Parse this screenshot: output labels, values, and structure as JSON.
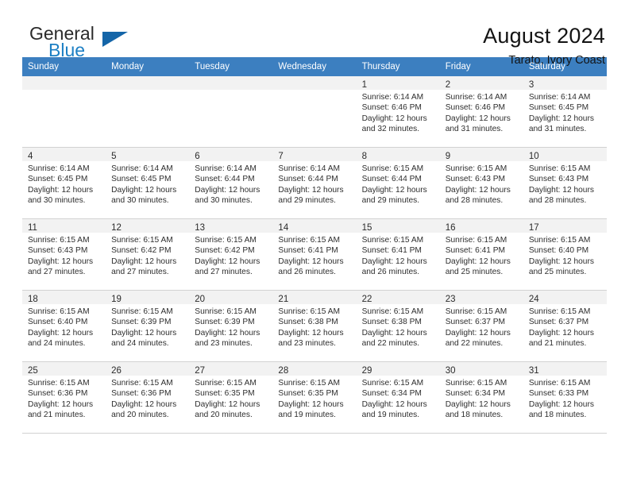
{
  "brand": {
    "name_part1": "General",
    "name_part2": "Blue",
    "flag_icon": "flag-triangle-icon"
  },
  "header": {
    "title": "August 2024",
    "subtitle": "Tarato, Ivory Coast"
  },
  "colors": {
    "header_row": "#3c7fc0",
    "brand_blue": "#1c7fc4",
    "daynum_bar": "#f2f2f2",
    "cell_border": "#d2d2d2"
  },
  "weekdays": [
    "Sunday",
    "Monday",
    "Tuesday",
    "Wednesday",
    "Thursday",
    "Friday",
    "Saturday"
  ],
  "labels": {
    "sunrise_prefix": "Sunrise:",
    "sunset_prefix": "Sunset:",
    "daylight_prefix": "Daylight:"
  },
  "weeks": [
    [
      {
        "day": "",
        "lines": []
      },
      {
        "day": "",
        "lines": []
      },
      {
        "day": "",
        "lines": []
      },
      {
        "day": "",
        "lines": []
      },
      {
        "day": "1",
        "lines": [
          "Sunrise: 6:14 AM",
          "Sunset: 6:46 PM",
          "Daylight: 12 hours",
          "and 32 minutes."
        ]
      },
      {
        "day": "2",
        "lines": [
          "Sunrise: 6:14 AM",
          "Sunset: 6:46 PM",
          "Daylight: 12 hours",
          "and 31 minutes."
        ]
      },
      {
        "day": "3",
        "lines": [
          "Sunrise: 6:14 AM",
          "Sunset: 6:45 PM",
          "Daylight: 12 hours",
          "and 31 minutes."
        ]
      }
    ],
    [
      {
        "day": "4",
        "lines": [
          "Sunrise: 6:14 AM",
          "Sunset: 6:45 PM",
          "Daylight: 12 hours",
          "and 30 minutes."
        ]
      },
      {
        "day": "5",
        "lines": [
          "Sunrise: 6:14 AM",
          "Sunset: 6:45 PM",
          "Daylight: 12 hours",
          "and 30 minutes."
        ]
      },
      {
        "day": "6",
        "lines": [
          "Sunrise: 6:14 AM",
          "Sunset: 6:44 PM",
          "Daylight: 12 hours",
          "and 30 minutes."
        ]
      },
      {
        "day": "7",
        "lines": [
          "Sunrise: 6:14 AM",
          "Sunset: 6:44 PM",
          "Daylight: 12 hours",
          "and 29 minutes."
        ]
      },
      {
        "day": "8",
        "lines": [
          "Sunrise: 6:15 AM",
          "Sunset: 6:44 PM",
          "Daylight: 12 hours",
          "and 29 minutes."
        ]
      },
      {
        "day": "9",
        "lines": [
          "Sunrise: 6:15 AM",
          "Sunset: 6:43 PM",
          "Daylight: 12 hours",
          "and 28 minutes."
        ]
      },
      {
        "day": "10",
        "lines": [
          "Sunrise: 6:15 AM",
          "Sunset: 6:43 PM",
          "Daylight: 12 hours",
          "and 28 minutes."
        ]
      }
    ],
    [
      {
        "day": "11",
        "lines": [
          "Sunrise: 6:15 AM",
          "Sunset: 6:43 PM",
          "Daylight: 12 hours",
          "and 27 minutes."
        ]
      },
      {
        "day": "12",
        "lines": [
          "Sunrise: 6:15 AM",
          "Sunset: 6:42 PM",
          "Daylight: 12 hours",
          "and 27 minutes."
        ]
      },
      {
        "day": "13",
        "lines": [
          "Sunrise: 6:15 AM",
          "Sunset: 6:42 PM",
          "Daylight: 12 hours",
          "and 27 minutes."
        ]
      },
      {
        "day": "14",
        "lines": [
          "Sunrise: 6:15 AM",
          "Sunset: 6:41 PM",
          "Daylight: 12 hours",
          "and 26 minutes."
        ]
      },
      {
        "day": "15",
        "lines": [
          "Sunrise: 6:15 AM",
          "Sunset: 6:41 PM",
          "Daylight: 12 hours",
          "and 26 minutes."
        ]
      },
      {
        "day": "16",
        "lines": [
          "Sunrise: 6:15 AM",
          "Sunset: 6:41 PM",
          "Daylight: 12 hours",
          "and 25 minutes."
        ]
      },
      {
        "day": "17",
        "lines": [
          "Sunrise: 6:15 AM",
          "Sunset: 6:40 PM",
          "Daylight: 12 hours",
          "and 25 minutes."
        ]
      }
    ],
    [
      {
        "day": "18",
        "lines": [
          "Sunrise: 6:15 AM",
          "Sunset: 6:40 PM",
          "Daylight: 12 hours",
          "and 24 minutes."
        ]
      },
      {
        "day": "19",
        "lines": [
          "Sunrise: 6:15 AM",
          "Sunset: 6:39 PM",
          "Daylight: 12 hours",
          "and 24 minutes."
        ]
      },
      {
        "day": "20",
        "lines": [
          "Sunrise: 6:15 AM",
          "Sunset: 6:39 PM",
          "Daylight: 12 hours",
          "and 23 minutes."
        ]
      },
      {
        "day": "21",
        "lines": [
          "Sunrise: 6:15 AM",
          "Sunset: 6:38 PM",
          "Daylight: 12 hours",
          "and 23 minutes."
        ]
      },
      {
        "day": "22",
        "lines": [
          "Sunrise: 6:15 AM",
          "Sunset: 6:38 PM",
          "Daylight: 12 hours",
          "and 22 minutes."
        ]
      },
      {
        "day": "23",
        "lines": [
          "Sunrise: 6:15 AM",
          "Sunset: 6:37 PM",
          "Daylight: 12 hours",
          "and 22 minutes."
        ]
      },
      {
        "day": "24",
        "lines": [
          "Sunrise: 6:15 AM",
          "Sunset: 6:37 PM",
          "Daylight: 12 hours",
          "and 21 minutes."
        ]
      }
    ],
    [
      {
        "day": "25",
        "lines": [
          "Sunrise: 6:15 AM",
          "Sunset: 6:36 PM",
          "Daylight: 12 hours",
          "and 21 minutes."
        ]
      },
      {
        "day": "26",
        "lines": [
          "Sunrise: 6:15 AM",
          "Sunset: 6:36 PM",
          "Daylight: 12 hours",
          "and 20 minutes."
        ]
      },
      {
        "day": "27",
        "lines": [
          "Sunrise: 6:15 AM",
          "Sunset: 6:35 PM",
          "Daylight: 12 hours",
          "and 20 minutes."
        ]
      },
      {
        "day": "28",
        "lines": [
          "Sunrise: 6:15 AM",
          "Sunset: 6:35 PM",
          "Daylight: 12 hours",
          "and 19 minutes."
        ]
      },
      {
        "day": "29",
        "lines": [
          "Sunrise: 6:15 AM",
          "Sunset: 6:34 PM",
          "Daylight: 12 hours",
          "and 19 minutes."
        ]
      },
      {
        "day": "30",
        "lines": [
          "Sunrise: 6:15 AM",
          "Sunset: 6:34 PM",
          "Daylight: 12 hours",
          "and 18 minutes."
        ]
      },
      {
        "day": "31",
        "lines": [
          "Sunrise: 6:15 AM",
          "Sunset: 6:33 PM",
          "Daylight: 12 hours",
          "and 18 minutes."
        ]
      }
    ]
  ]
}
